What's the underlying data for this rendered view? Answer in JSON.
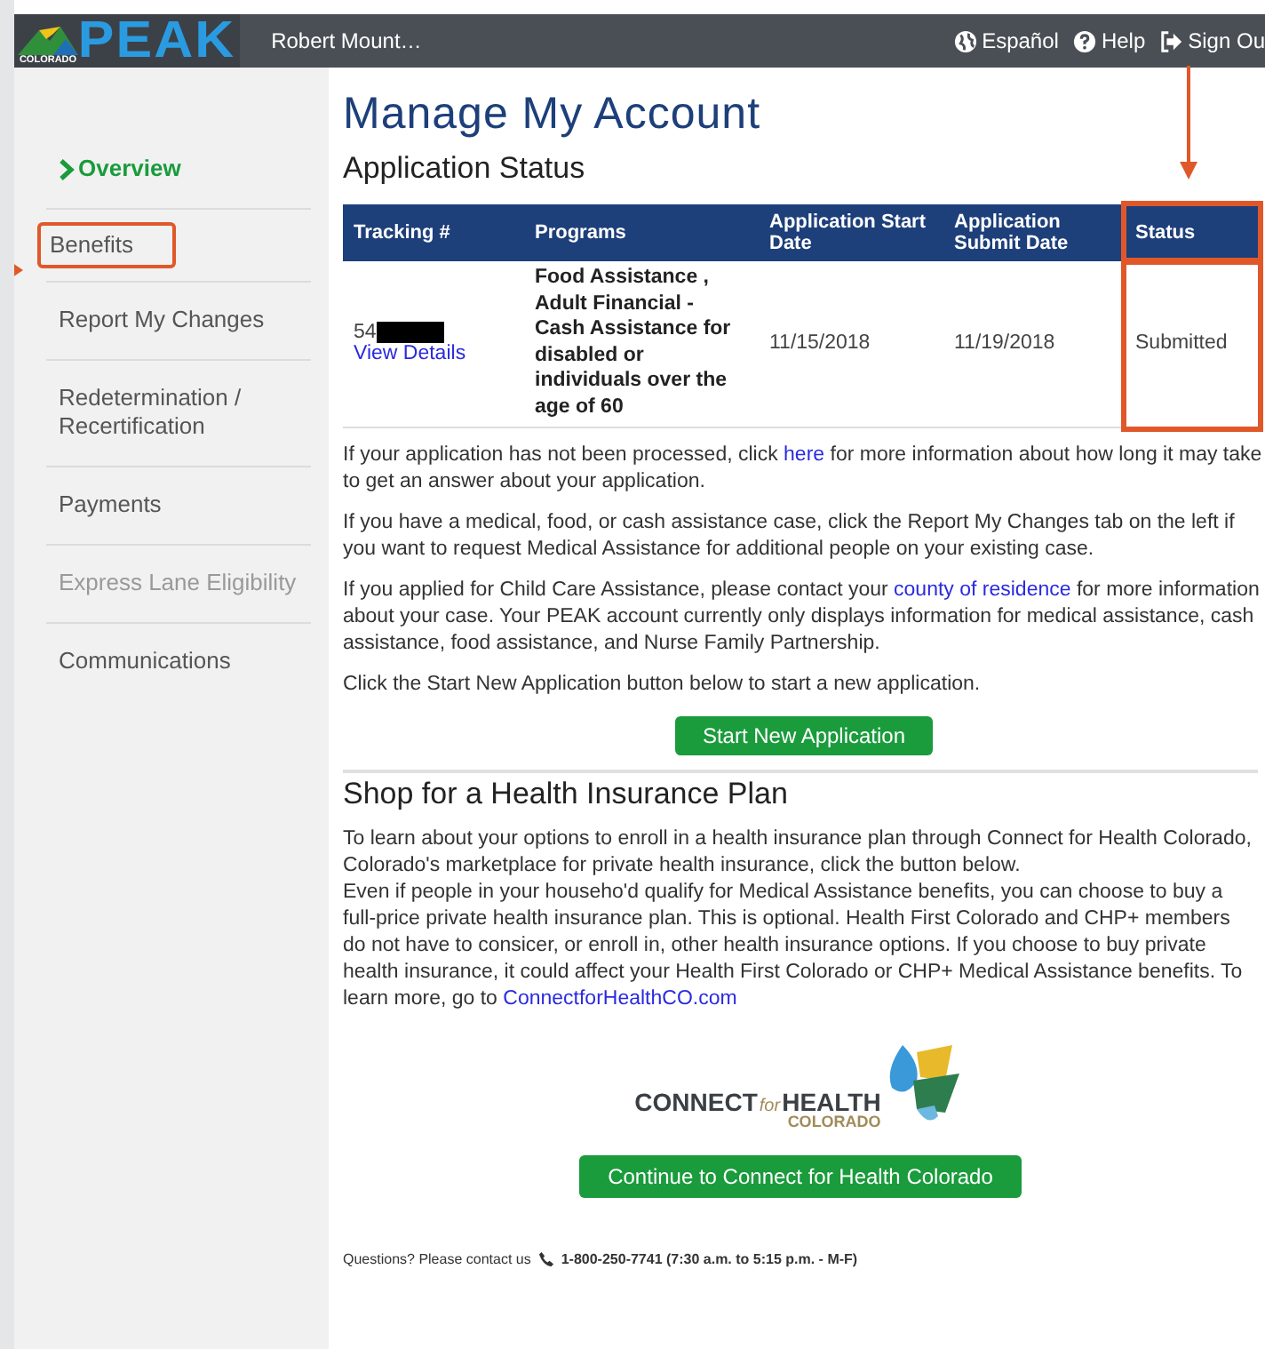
{
  "header": {
    "logo": {
      "word": "PEAK",
      "state": "COLORADO"
    },
    "user": "Robert Mount…",
    "links": [
      {
        "kind": "globe",
        "label": "Español"
      },
      {
        "kind": "help",
        "label": "Help"
      },
      {
        "kind": "signout",
        "label": "Sign Ou"
      }
    ]
  },
  "sidebar": {
    "items": [
      {
        "label": "Overview",
        "selected": true,
        "disabled": false,
        "highlighted": false
      },
      {
        "label": "Benefits",
        "selected": false,
        "disabled": false,
        "highlighted": true
      },
      {
        "label": "Report My Changes",
        "selected": false,
        "disabled": false,
        "highlighted": false
      },
      {
        "label": "Redetermination / Recertification",
        "selected": false,
        "disabled": false,
        "highlighted": false
      },
      {
        "label": "Payments",
        "selected": false,
        "disabled": false,
        "highlighted": false
      },
      {
        "label": "Express Lane Eligibility",
        "selected": false,
        "disabled": true,
        "highlighted": false
      },
      {
        "label": "Communications",
        "selected": false,
        "disabled": false,
        "highlighted": false
      }
    ]
  },
  "page_title": "Manage My Account",
  "application_status": {
    "heading": "Application Status",
    "table": {
      "columns": [
        {
          "label": "Tracking #",
          "highlighted": false
        },
        {
          "label": "Programs",
          "highlighted": false
        },
        {
          "label": "Application Start Date",
          "highlighted": false
        },
        {
          "label": "Application Submit Date",
          "highlighted": false
        },
        {
          "label": "Status",
          "highlighted": true
        }
      ],
      "rows": [
        {
          "tracking": "54",
          "redacted": true,
          "details_link": "View Details",
          "programs": "Food Assistance , Adult Financial - Cash Assistance for disabled or individuals over the age of 60",
          "start_date": "11/15/2018",
          "submit_date": "11/19/2018",
          "status": "Submitted"
        }
      ]
    },
    "paragraphs": [
      {
        "before": "If your application has not been processed, click ",
        "link": "here",
        "after": " for more information about how long it may take to get an answer about your application."
      },
      {
        "before": "If you have a medical, food, or cash assistance case, click the Report My Changes tab on the left if you want to request Medical Assistance for additional people on your existing case."
      },
      {
        "before": "If you applied for Child Care Assistance, please contact your ",
        "link": "county of residence",
        "after": " for more information about your case. Your PEAK account currently only displays information for medical assistance, cash assistance, food assistance, and Nurse Family Partnership."
      },
      {
        "before": "Click the Start New Application button below to start a new application."
      }
    ],
    "button": "Start New Application"
  },
  "health_insurance": {
    "heading": "Shop for a Health Insurance Plan",
    "intro": "To learn about your options to enroll in a health insurance plan through Connect for Health Colorado, Colorado's marketplace for private health insurance, click the button below.",
    "body": {
      "before": "Even if people in your househo'd qualify for Medical Assistance benefits, you can choose to buy a full-price private health insurance plan. This is optional. Health First Colorado and CHP+ members do not have to consicer, or enroll in, other health insurance options. If you choose to buy private health insurance, it could affect your Health First Colorado or CHP+ Medical Assistance benefits. To learn more, go to ",
      "link": "ConnectforHealthCO.com"
    },
    "logo": {
      "connect": "CONNECT",
      "for": "for",
      "health": "HEALTH",
      "state": "COLORADO"
    },
    "button": "Continue to Connect for Health Colorado"
  },
  "footer": {
    "text": "Questions? Please contact us",
    "phone": "1-800-250-7741 (7:30 a.m. to 5:15 p.m. - M-F)"
  }
}
